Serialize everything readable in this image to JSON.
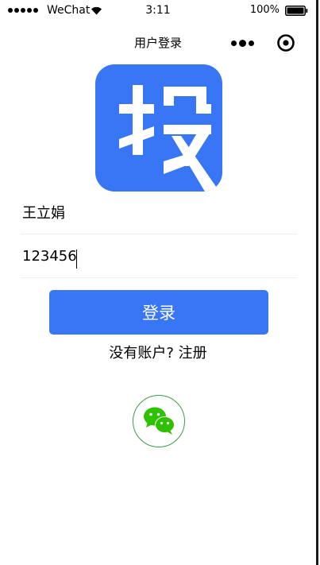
{
  "status_bar": {
    "carrier": "WeChat",
    "time": "3:11",
    "battery": "100%"
  },
  "nav": {
    "title": "用户登录"
  },
  "logo": {
    "glyph": "投",
    "color": "#3876f6"
  },
  "form": {
    "username_value": "王立娟",
    "password_value": "123456",
    "login_label": "登录",
    "register_text": "没有账户? 注册"
  },
  "colors": {
    "primary": "#3876f6",
    "wechat_green": "#2dc100",
    "wechat_border": "#3f9a4a"
  },
  "icons": {
    "signal": "signal-dots-icon",
    "wifi": "wifi-icon",
    "battery": "battery-icon",
    "more": "more-dots-icon",
    "close": "target-close-icon",
    "wechat": "wechat-icon"
  }
}
